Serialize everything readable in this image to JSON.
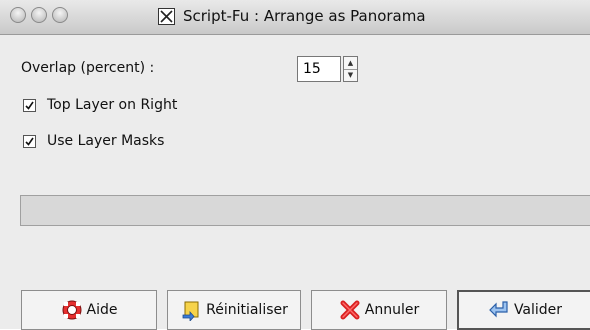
{
  "window": {
    "title": "Script-Fu : Arrange as Panorama"
  },
  "form": {
    "overlap_label": "Overlap (percent) :",
    "overlap_value": "15",
    "top_layer_label": "Top Layer on Right",
    "top_layer_checked": true,
    "layer_masks_label": "Use Layer Masks",
    "layer_masks_checked": true
  },
  "progress": {
    "value": 0
  },
  "buttons": {
    "help": "Aide",
    "reset": "Réinitialiser",
    "cancel": "Annuler",
    "ok": "Valider"
  },
  "icons": [
    "close-traffic-icon",
    "minimize-traffic-icon",
    "zoom-traffic-icon",
    "x11-icon",
    "spin-up-icon",
    "spin-down-icon",
    "checkmark-icon",
    "lifebuoy-icon",
    "reset-icon",
    "cancel-x-icon",
    "ok-arrow-icon"
  ]
}
